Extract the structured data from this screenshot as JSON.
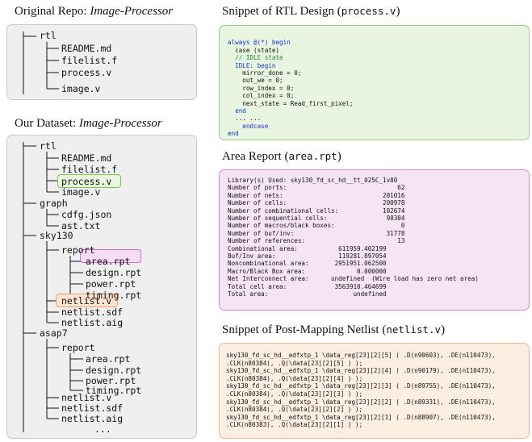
{
  "original_repo": {
    "title_prefix": "Original Repo: ",
    "title_name": "Image-Processor",
    "tree": [
      "rtl",
      "README.md",
      "filelist.f",
      "process.v",
      "image.v"
    ]
  },
  "dataset": {
    "title_prefix": "Our Dataset: ",
    "title_name": "Image-Processor",
    "tree": {
      "rtl": "rtl",
      "rtl_readme": "README.md",
      "rtl_filelist": "filelist.f",
      "rtl_process": "process.v",
      "rtl_image": "image.v",
      "graph": "graph",
      "cdfg": "cdfg.json",
      "ast": "ast.txt",
      "sky130": "sky130",
      "sky_report": "report",
      "sky_area": "area.rpt",
      "sky_design": "design.rpt",
      "sky_power": "power.rpt",
      "sky_timing": "timing.rpt",
      "sky_netlist_v": "netlist.v",
      "sky_netlist_sdf": "netlist.sdf",
      "sky_netlist_aig": "netlist.aig",
      "asap7": "asap7",
      "asap_report": "report",
      "asap_area": "area.rpt",
      "asap_design": "design.rpt",
      "asap_power": "power.rpt",
      "asap_timing": "timing.rpt",
      "asap_netlist_v": "netlist.v",
      "asap_netlist_sdf": "netlist.sdf",
      "asap_netlist_aig": "netlist.aig",
      "ellipsis": "..."
    }
  },
  "rtl_snippet": {
    "title": "Snippet of RTL Design (",
    "file": "process.v",
    "title_end": ")",
    "lines": [
      "always @(*) begin",
      "  case (state)",
      "  // IDLE state",
      "  IDLE: begin",
      "    mirror_done = 0;",
      "    out_we = 0;",
      "    row_index = 0;",
      "    col_index = 0;",
      "    next_state = Read_first_pixel;",
      "  end",
      "  ... ...",
      "    endcase",
      "end"
    ]
  },
  "area_report": {
    "title": "Area Report (",
    "file": "area.rpt",
    "title_end": ")",
    "lines": [
      "Library(s) Used: sky130_fd_sc_hd__tt_025C_1v80",
      "Number of ports:                              62",
      "Number of nets:                           201016",
      "Number of cells:                          200978",
      "Number of combinational cells:            102674",
      "Number of sequential cells:                98304",
      "Number of macros/black boxes:                  0",
      "Number of buf/inv:                         31778",
      "Number of references:                         13",
      "Combinational area:           611959.402199",
      "Buf/Inv area:                 119281.897054",
      "Noncombinational area:       2951951.062500",
      "Macro/Black Box area:              0.000000",
      "Net Interconnect area:      undefined  (Wire load has zero net area)",
      "Total cell area:             3563910.464699",
      "Total area:                       undefined"
    ]
  },
  "netlist_snippet": {
    "title": "Snippet of Post-Mapping Netlist (",
    "file": "netlist.v",
    "title_end": ")",
    "lines": [
      "sky130_fd_sc_hd__edfxtp_1 \\data_reg[23][2][5] ( .D(n90603), .DE(n110473),",
      ".CLK(n80384), .Q(\\data[23][2][5] ) );",
      "sky130_fd_sc_hd__edfxtp_1 \\data_reg[23][2][4] ( .D(n90179), .DE(n110473),",
      ".CLK(n80384), .Q(\\data[23][2][4] ) );",
      "sky130_fd_sc_hd__edfxtp_1 \\data_reg[23][2][3] ( .D(n89755), .DE(n110473),",
      ".CLK(n80384), .Q(\\data[23][2][3] ) );",
      "sky130_fd_sc_hd__edfxtp_1 \\data_reg[23][2][2] ( .D(n89331), .DE(n110473),",
      ".CLK(n80384), .Q(\\data[23][2][2] ) );",
      "sky130_fd_sc_hd__edfxtp_1 \\data_reg[23][2][1] ( .D(n88907), .DE(n110473),",
      ".CLK(n80383), .Q(\\data[23][2][1] ) );"
    ]
  },
  "colors": {
    "green_border": "#9ccf86",
    "pink_border": "#d38bd0",
    "orange_border": "#f1b890",
    "gray_border": "#c8c8c8"
  }
}
